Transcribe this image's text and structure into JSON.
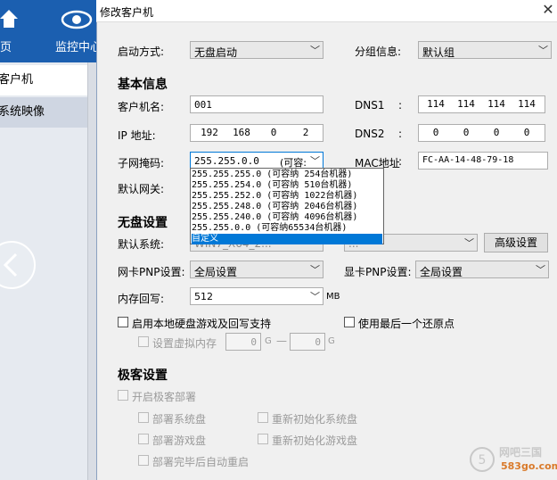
{
  "app": {
    "nav": {
      "home_label": "页",
      "monitor_label": "监控中心"
    },
    "left_items": [
      "客户机",
      "系统映像"
    ]
  },
  "dialog": {
    "title": "修改客户机",
    "boot_mode": {
      "label": "启动方式:",
      "value": "无盘启动"
    },
    "group": {
      "label": "分组信息:",
      "value": "默认组"
    },
    "basic_section": "基本信息",
    "client_name": {
      "label": "客户机名:",
      "value": "001"
    },
    "dns1": {
      "label": "DNS1",
      "colon": ":",
      "octets": [
        "114",
        "114",
        "114",
        "114"
      ]
    },
    "ip": {
      "label": "IP  地址:",
      "octets": [
        "192",
        "168",
        "0",
        "2"
      ]
    },
    "dns2": {
      "label": "DNS2",
      "colon": ":",
      "octets": [
        "0",
        "0",
        "0",
        "0"
      ]
    },
    "subnet": {
      "label": "子网掩码:",
      "value": "255.255.0.0",
      "hint": "(可容:"
    },
    "mac": {
      "label": "MAC地址",
      "colon": ":",
      "value": "FC-AA-14-48-79-18"
    },
    "gateway": {
      "label": "默认网关:"
    },
    "subnet_options": [
      "255.255.255.0   (可容纳  254台机器)",
      "255.255.254.0   (可容纳  510台机器)",
      "255.255.252.0   (可容纳 1022台机器)",
      "255.255.248.0   (可容纳 2046台机器)",
      "255.255.240.0   (可容纳 4096台机器)",
      "255.255.0.0     (可容纳65534台机器)",
      "自定义"
    ],
    "diskless_section": "无盘设置",
    "default_system": {
      "label": "默认系统:",
      "value": "WIN7_X64_2..."
    },
    "system_combo2": {
      "value": "..."
    },
    "advanced_button": "高级设置",
    "nic_pnp": {
      "label": "网卡PNP设置:",
      "value": "全局设置"
    },
    "gpu_pnp": {
      "label": "显卡PNP设置:",
      "value": "全局设置"
    },
    "mem_writeback": {
      "label": "内存回写:",
      "value": "512",
      "unit": "MB"
    },
    "local_disk_check": "启用本地硬盘游戏及回写支持",
    "last_restore_check": "使用最后一个还原点",
    "virtual_mem": {
      "label": "设置虚拟内存",
      "min": "0",
      "max": "0",
      "unit": "G",
      "dash": "—"
    },
    "extreme_section": "极客设置",
    "extreme_enable": "开启极客部署",
    "deploy_system": "部署系统盘",
    "reinit_system": "重新初始化系统盘",
    "deploy_game": "部署游戏盘",
    "reinit_game": "重新初始化游戏盘",
    "auto_reboot": "部署完毕后自动重启"
  },
  "watermark": {
    "text": "网吧三国",
    "url_text": "583go.com"
  }
}
